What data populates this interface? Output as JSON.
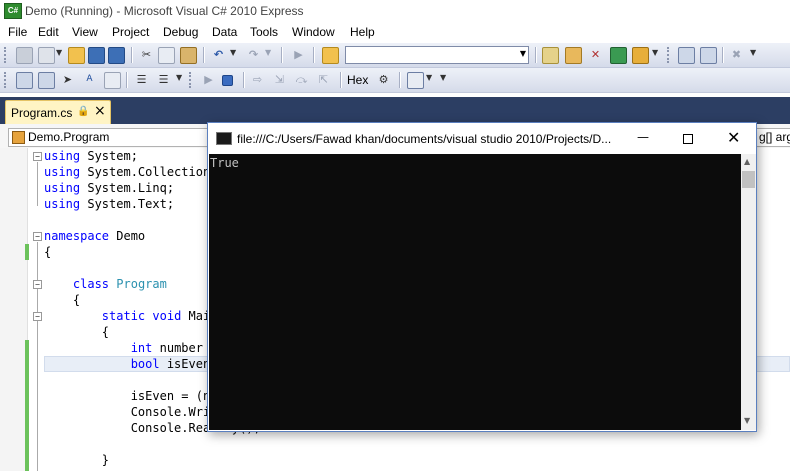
{
  "app": {
    "icon_text": "C#",
    "title": "Demo (Running) - Microsoft Visual C# 2010 Express"
  },
  "menu": [
    "File",
    "Edit",
    "View",
    "Project",
    "Debug",
    "Data",
    "Tools",
    "Window",
    "Help"
  ],
  "toolbar2": {
    "hex_label": "Hex"
  },
  "tab": {
    "label": "Program.cs"
  },
  "navbar": {
    "class_value": "Demo.Program",
    "member_value": "g[] arg"
  },
  "code_lines": [
    {
      "t": "using System;"
    },
    {
      "t": "using System.Collection"
    },
    {
      "t": "using System.Linq;"
    },
    {
      "t": "using System.Text;"
    },
    {
      "t": ""
    },
    {
      "t": "namespace Demo"
    },
    {
      "t": "{"
    },
    {
      "t": ""
    },
    {
      "t": "    class Program"
    },
    {
      "t": "    {"
    },
    {
      "t": "        static void Mai"
    },
    {
      "t": "        {"
    },
    {
      "t": "            int number ="
    },
    {
      "t": "            bool isEven"
    },
    {
      "t": ""
    },
    {
      "t": "            isEven = (nu"
    },
    {
      "t": "            Console.Writ"
    },
    {
      "t": "            Console.ReadKey();"
    },
    {
      "t": ""
    },
    {
      "t": "        }"
    }
  ],
  "console": {
    "title": "file:///C:/Users/Fawad khan/documents/visual studio 2010/Projects/D...",
    "output": "True"
  }
}
